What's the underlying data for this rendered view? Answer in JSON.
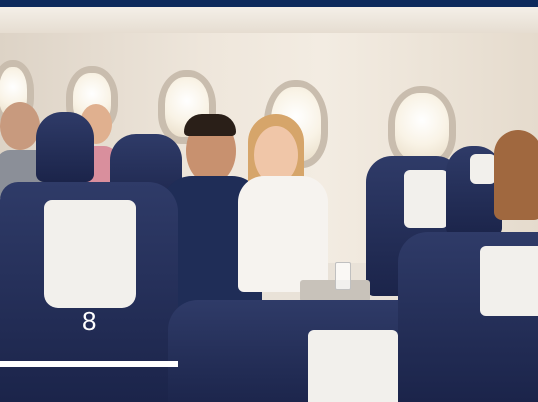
{
  "seat_label": "8",
  "colors": {
    "brand_navy": "#0d2a5c",
    "seat_blue": "#1b244a",
    "headrest_cover": "#f2f0ec"
  }
}
